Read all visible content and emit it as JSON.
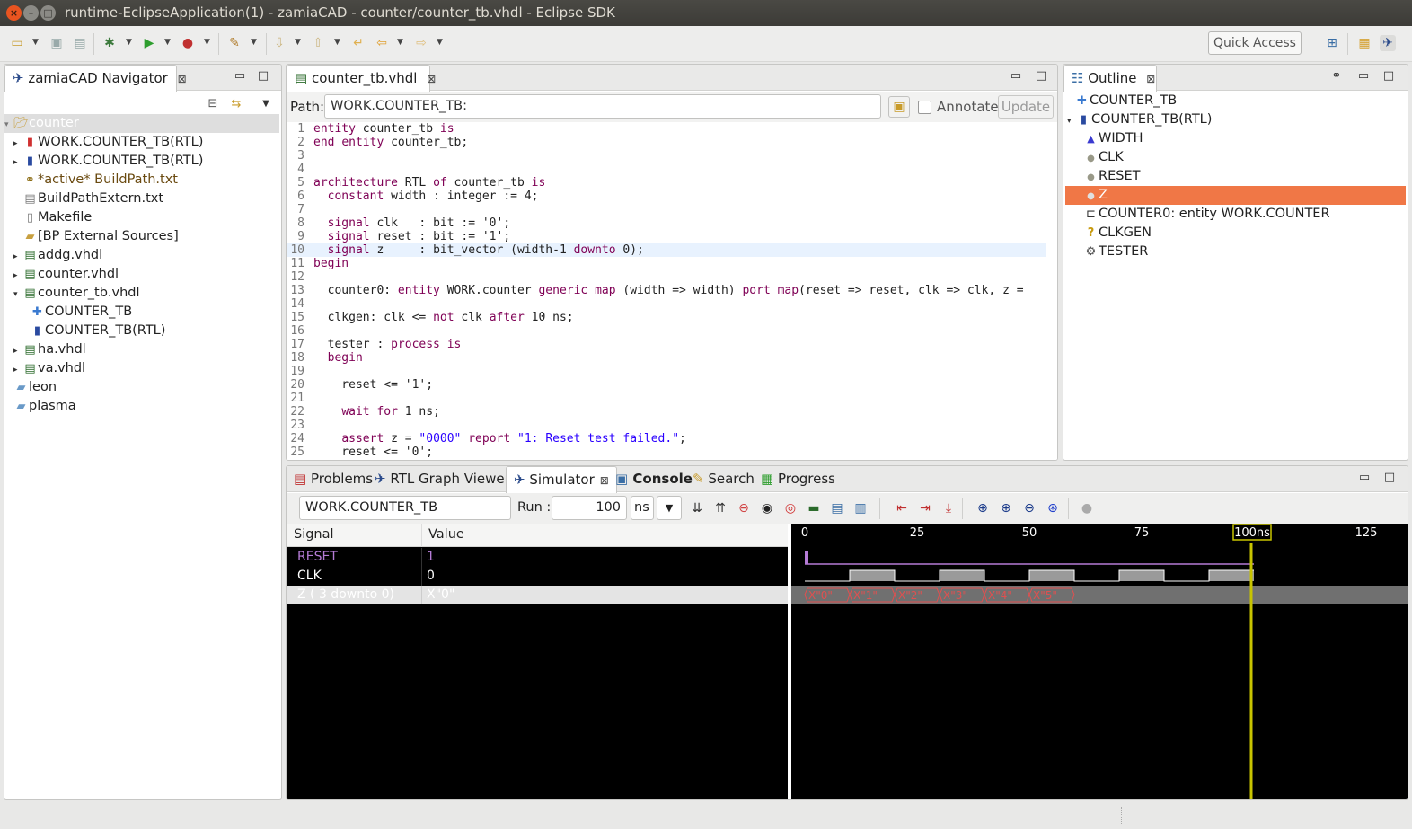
{
  "window": {
    "title": "runtime-EclipseApplication(1) - zamiaCAD - counter/counter_tb.vhdl - Eclipse SDK",
    "close": "×",
    "minimize": "–",
    "maximize": "□"
  },
  "toolbar": {
    "quick_access": "Quick Access"
  },
  "navigator": {
    "tab": "zamiaCAD Navigator",
    "items": [
      {
        "label": "counter",
        "twisty": "▾",
        "icon": "folder-open-icon"
      },
      {
        "label": "WORK.COUNTER_TB(RTL)",
        "twisty": "▸"
      },
      {
        "label": "WORK.COUNTER_TB(RTL)",
        "twisty": "▸"
      },
      {
        "label": "*active* BuildPath.txt"
      },
      {
        "label": "BuildPathExtern.txt"
      },
      {
        "label": "Makefile"
      },
      {
        "label": "[BP External Sources]"
      },
      {
        "label": "addg.vhdl",
        "twisty": "▸"
      },
      {
        "label": "counter.vhdl",
        "twisty": "▸"
      },
      {
        "label": "counter_tb.vhdl",
        "twisty": "▾"
      },
      {
        "label": "COUNTER_TB"
      },
      {
        "label": "COUNTER_TB(RTL)"
      },
      {
        "label": "ha.vhdl",
        "twisty": "▸"
      },
      {
        "label": "va.vhdl",
        "twisty": "▸"
      },
      {
        "label": "leon"
      },
      {
        "label": "plasma"
      }
    ]
  },
  "editor": {
    "tab": "counter_tb.vhdl",
    "path_label": "Path:",
    "path_value": "WORK.COUNTER_TB:",
    "annotate": "Annotate",
    "update": "Update",
    "lines": [
      "entity counter_tb is",
      "end entity counter_tb;",
      "",
      "",
      "architecture RTL of counter_tb is",
      "  constant width : integer := 4;",
      "",
      "  signal clk   : bit := '0';",
      "  signal reset : bit := '1';",
      "  signal z     : bit_vector (width-1 downto 0);",
      "begin",
      "",
      "  counter0: entity WORK.counter generic map (width => width) port map(reset => reset, clk => clk, z =",
      "",
      "  clkgen: clk <= not clk after 10 ns;",
      "",
      "  tester : process is",
      "  begin",
      "",
      "    reset <= '1';",
      "",
      "    wait for 1 ns;",
      "",
      "    assert z = \"0000\" report \"1: Reset test failed.\";",
      "    reset <= '0';"
    ]
  },
  "outline": {
    "tab": "Outline",
    "items": [
      {
        "label": "COUNTER_TB"
      },
      {
        "label": "COUNTER_TB(RTL)",
        "twisty": "▾"
      },
      {
        "label": "WIDTH"
      },
      {
        "label": "CLK"
      },
      {
        "label": "RESET"
      },
      {
        "label": "Z",
        "selected": true
      },
      {
        "label": "COUNTER0: entity WORK.COUNTER"
      },
      {
        "label": "CLKGEN"
      },
      {
        "label": "TESTER"
      }
    ]
  },
  "bottom": {
    "tabs": [
      "Problems",
      "RTL Graph Viewer",
      "Simulator",
      "Console",
      "Search",
      "Progress"
    ],
    "toplevel": "WORK.COUNTER_TB",
    "run_label": "Run :",
    "run_value": "100",
    "unit": "ns",
    "col_signal": "Signal",
    "col_value": "Value",
    "signals": [
      {
        "name": "RESET",
        "value": "1"
      },
      {
        "name": "CLK",
        "value": "0"
      },
      {
        "name": "Z ( 3 downto 0)",
        "value": "X\"0\""
      }
    ],
    "timeline": {
      "ticks": [
        "0",
        "25",
        "50",
        "75",
        "125"
      ],
      "cursor": "100ns"
    },
    "z_values": [
      "X\"0\"",
      "X\"1\"",
      "X\"2\"",
      "X\"3\"",
      "X\"4\"",
      "X\"5\""
    ]
  },
  "colors": {
    "accent": "#f07746",
    "reset_signal": "#b57bd6",
    "cursor": "#c8c400",
    "z_trace": "#e05050"
  }
}
